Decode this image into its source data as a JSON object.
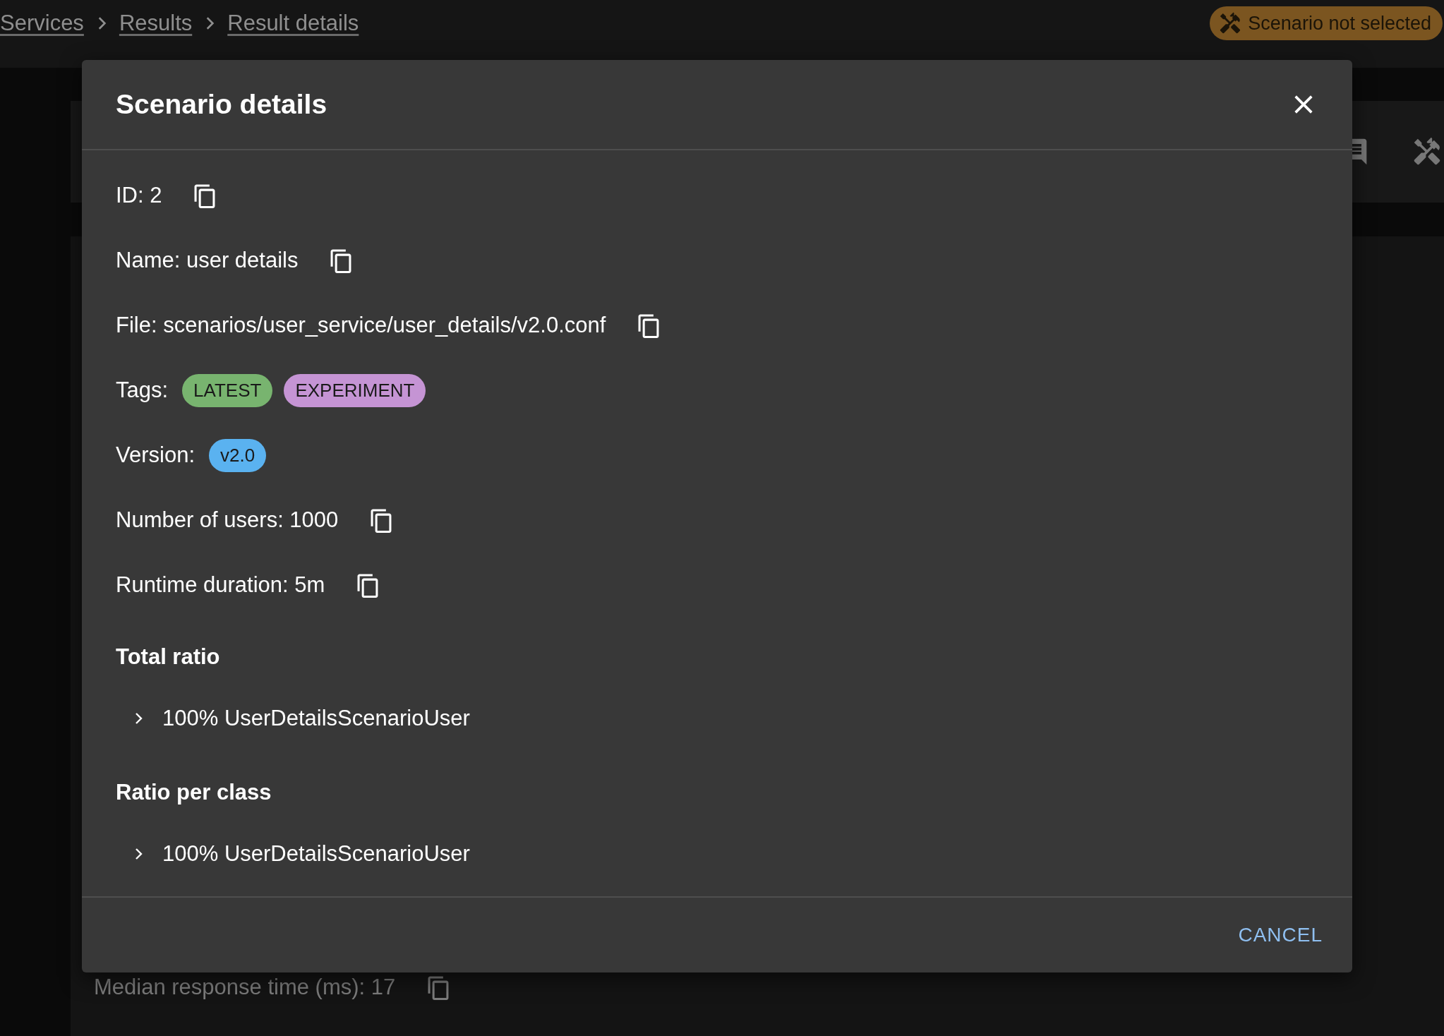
{
  "breadcrumbs": [
    {
      "label": "Services"
    },
    {
      "label": "Results"
    },
    {
      "label": "Result details"
    }
  ],
  "scenario_badge": {
    "label": "Scenario not selected"
  },
  "background": {
    "rows": [
      {
        "label": "Median response time (ms): 17"
      }
    ]
  },
  "dialog": {
    "title": "Scenario details",
    "fields": [
      {
        "kind": "copy",
        "text": "ID: 2"
      },
      {
        "kind": "copy",
        "text": "Name: user details"
      },
      {
        "kind": "copy",
        "text": "File: scenarios/user_service/user_details/v2.0.conf"
      },
      {
        "kind": "tags",
        "label": "Tags:",
        "tags": [
          {
            "label": "LATEST",
            "color": "#78b46f"
          },
          {
            "label": "EXPERIMENT",
            "color": "#c594d4"
          }
        ]
      },
      {
        "kind": "tags",
        "label": "Version:",
        "tags": [
          {
            "label": "v2.0",
            "color": "#5ab2f0"
          }
        ]
      },
      {
        "kind": "copy",
        "text": "Number of users: 1000"
      },
      {
        "kind": "copy",
        "text": "Runtime duration: 5m"
      }
    ],
    "sections": [
      {
        "title": "Total ratio",
        "items": [
          {
            "label": "100% UserDetailsScenarioUser",
            "expanded": false
          }
        ]
      },
      {
        "title": "Ratio per class",
        "items": [
          {
            "label": "100% UserDetailsScenarioUser",
            "expanded": false
          }
        ]
      }
    ],
    "buttons": [
      {
        "label": "CANCEL"
      }
    ]
  }
}
